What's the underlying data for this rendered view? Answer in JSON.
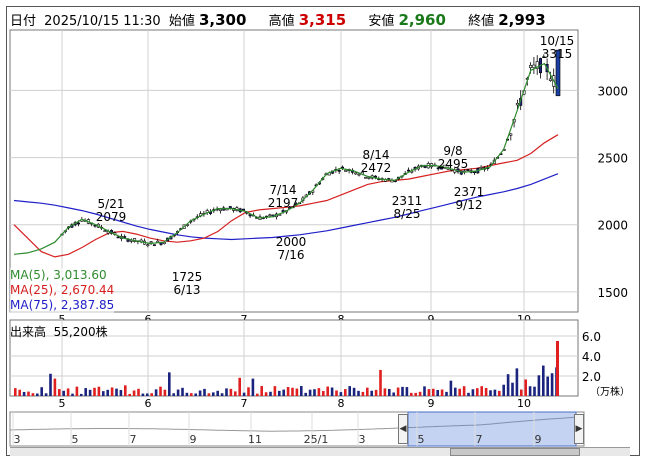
{
  "header": {
    "date_label": "日付",
    "datetime": "2025/10/15 11:30",
    "open_label": "始値",
    "open": "3,300",
    "high_label": "高値",
    "high": "3,315",
    "low_label": "安値",
    "low": "2,960",
    "close_label": "終値",
    "close": "2,993",
    "colors": {
      "high": "#cc0000",
      "low": "#1a7a1a"
    }
  },
  "ma_legend": [
    {
      "label": "MA(5)",
      "value": "3,013.60",
      "color": "#2e8b2e"
    },
    {
      "label": "MA(25)",
      "value": "2,670.44",
      "color": "#d62020"
    },
    {
      "label": "MA(75)",
      "value": "2,387.85",
      "color": "#2020c8"
    }
  ],
  "volume": {
    "label": "出来高",
    "value": "55,200株",
    "unit": "（万株）",
    "yticks": [
      "6.0",
      "4.0",
      "2.0"
    ]
  },
  "chart_data": [
    {
      "type": "candlestick",
      "title": "",
      "ylim": [
        1350,
        3450
      ],
      "yticks": [
        1500,
        2000,
        2500,
        3000
      ],
      "x_months": [
        "5",
        "6",
        "7",
        "8",
        "9",
        "10"
      ],
      "grid": true,
      "annotations": [
        {
          "date": "5/21",
          "value": "2079"
        },
        {
          "date": "6/13",
          "value": "1725"
        },
        {
          "date": "7/14",
          "value": "2197"
        },
        {
          "date": "7/16",
          "value": "2000"
        },
        {
          "date": "8/14",
          "value": "2472"
        },
        {
          "date": "8/25",
          "value": "2311"
        },
        {
          "date": "9/8",
          "value": "2495"
        },
        {
          "date": "9/12",
          "value": "2371"
        },
        {
          "date": "10/15",
          "value": "3315"
        }
      ],
      "ma75": [
        2180,
        2170,
        2160,
        2145,
        2125,
        2105,
        2080,
        2050,
        2020,
        1990,
        1965,
        1945,
        1925,
        1910,
        1900,
        1895,
        1890,
        1895,
        1900,
        1905,
        1915,
        1925,
        1940,
        1955,
        1975,
        1995,
        2015,
        2035,
        2055,
        2080,
        2105,
        2130,
        2155,
        2180,
        2205,
        2225,
        2245,
        2270,
        2300,
        2340,
        2380
      ],
      "ma25": [
        2000,
        1900,
        1800,
        1760,
        1780,
        1830,
        1890,
        1940,
        1950,
        1930,
        1900,
        1880,
        1870,
        1880,
        1900,
        1950,
        2030,
        2090,
        2110,
        2120,
        2130,
        2140,
        2160,
        2180,
        2220,
        2260,
        2300,
        2320,
        2330,
        2340,
        2360,
        2380,
        2400,
        2410,
        2420,
        2440,
        2460,
        2480,
        2530,
        2610,
        2670
      ],
      "ma5": [
        1780,
        1790,
        1820,
        1870,
        1980,
        2040,
        2000,
        1950,
        1900,
        1880,
        1860,
        1870,
        1940,
        2030,
        2080,
        2120,
        2120,
        2100,
        2050,
        2060,
        2100,
        2160,
        2260,
        2380,
        2420,
        2400,
        2360,
        2340,
        2330,
        2390,
        2440,
        2440,
        2420,
        2390,
        2400,
        2430,
        2560,
        2850,
        3150,
        3200,
        3013
      ]
    },
    {
      "type": "bar",
      "title": "",
      "ylim": [
        0,
        7
      ],
      "yticks": [
        2.0,
        4.0,
        6.0
      ]
    }
  ],
  "navigator": {
    "ticks": [
      "3",
      "5",
      "7",
      "9",
      "11",
      "25/1",
      "3",
      "5",
      "7",
      "9"
    ]
  }
}
